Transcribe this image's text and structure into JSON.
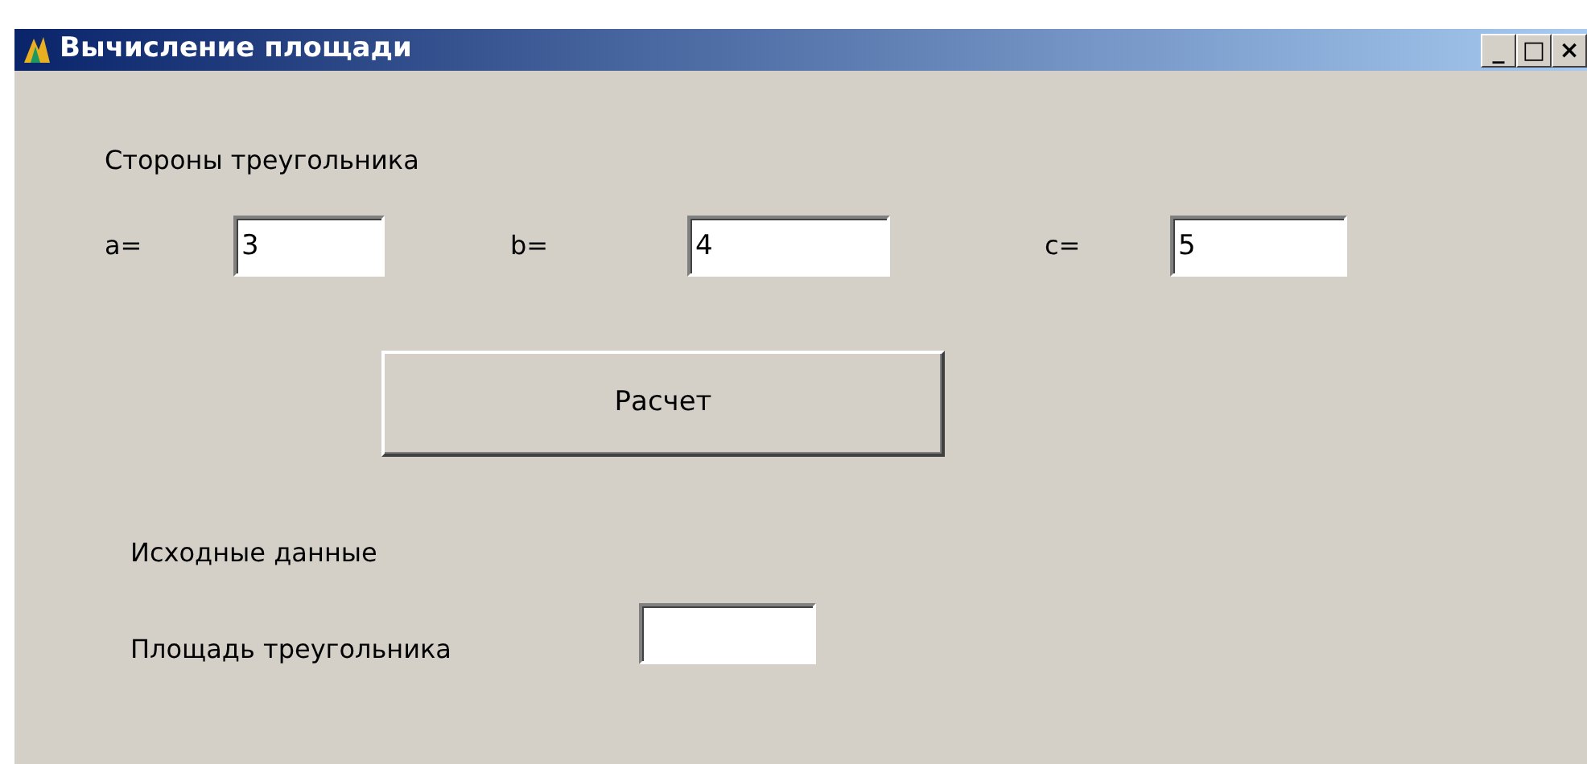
{
  "window": {
    "title": "Вычисление площади",
    "controls": [
      "_",
      "□",
      "×"
    ]
  },
  "sides_label": "Стороны треугольника",
  "sides": [
    {
      "label": "a=",
      "value": "3"
    },
    {
      "label": "b=",
      "value": "4"
    },
    {
      "label": "c=",
      "value": "5"
    }
  ],
  "calc_button": "Расчет",
  "input_label": "Исходные данные",
  "area": {
    "label": "Площадь треугольника"
  }
}
